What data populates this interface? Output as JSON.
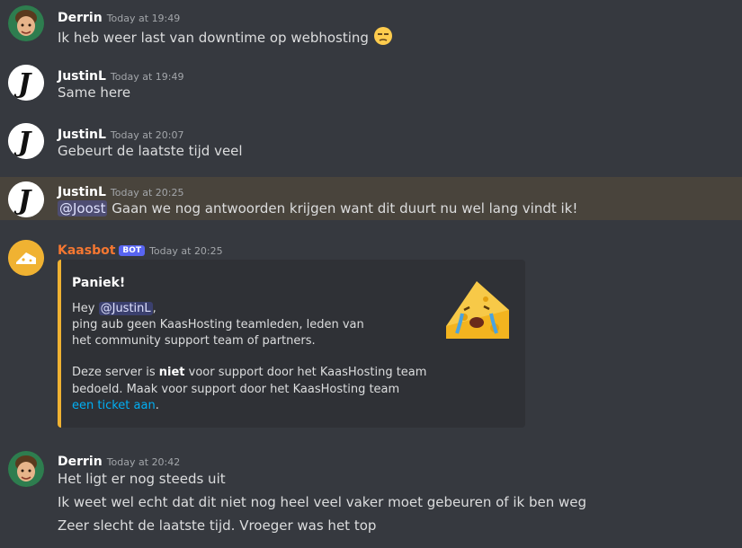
{
  "messages": [
    {
      "author": "Derrin",
      "timestamp": "Today at 19:49",
      "text": "Ik heb weer last van downtime op webhosting"
    },
    {
      "author": "JustinL",
      "timestamp": "Today at 19:49",
      "text": "Same here"
    },
    {
      "author": "JustinL",
      "timestamp": "Today at 20:07",
      "text": "Gebeurt de laatste tijd veel"
    },
    {
      "author": "JustinL",
      "timestamp": "Today at 20:25",
      "mention": "@Joost",
      "text": " Gaan we nog antwoorden krijgen want dit duurt nu wel lang vindt ik!"
    },
    {
      "author": "Kaasbot",
      "bot_tag": "BOT",
      "timestamp": "Today at 20:25"
    },
    {
      "author": "Derrin",
      "timestamp": "Today at 20:42",
      "lines": [
        "Het ligt er nog steeds uit",
        "Ik weet wel echt dat dit niet nog heel veel vaker moet gebeuren of ik ben weg",
        "Zeer slecht de laatste tijd. Vroeger was het top"
      ]
    }
  ],
  "embed": {
    "title": "Paniek!",
    "hey": "Hey ",
    "mention": "@JustinL",
    "hey_suffix": ",",
    "line2": "ping aub geen KaasHosting teamleden, leden van",
    "line3": "het community support team of partners.",
    "line4_a": "Deze server is ",
    "line4_bold": "niet",
    "line4_b": " voor support door het KaasHosting team",
    "line5": "bedoeld. Maak voor support door het KaasHosting team",
    "link": "een ticket aan",
    "link_suffix": "."
  },
  "colors": {
    "background": "#36393f",
    "highlight": "#49443c",
    "embed_bg": "#2f3136",
    "embed_accent": "#f0b232",
    "bot_name": "#f57731",
    "bot_tag": "#5865f2",
    "link": "#00aff4"
  },
  "icons": {
    "derrin_avatar": "memoji-avatar",
    "justin_avatar": "letter-j-avatar",
    "kaasbot_avatar": "cheese-avatar",
    "unamused_emoji": "unamused-face-emoji",
    "crying_cheese": "crying-cheese-emoji"
  }
}
